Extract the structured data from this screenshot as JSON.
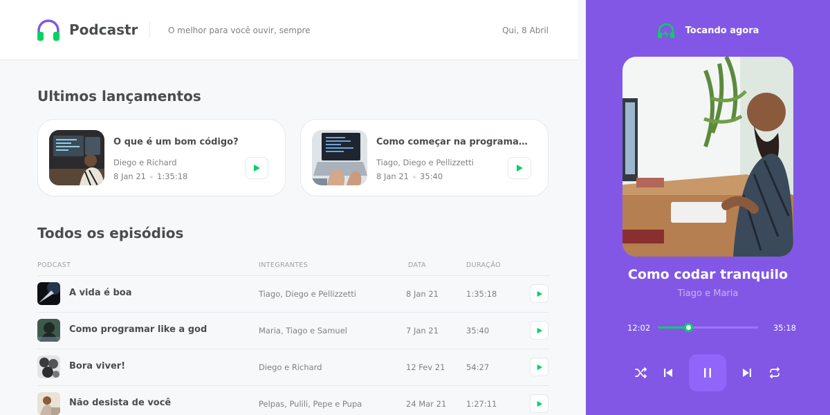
{
  "header": {
    "brand": "Podcastr",
    "tagline": "O melhor para você ouvir, sempre",
    "date": "Qui, 8 Abril"
  },
  "latest": {
    "title": "Ultimos lançamentos",
    "episodes": [
      {
        "title": "O que é um bom código?",
        "members": "Diego e Richard",
        "date": "8 Jan 21",
        "duration": "1:35:18"
      },
      {
        "title": "Como começar na programação",
        "members": "Tiago, Diego e Pellizzetti",
        "date": "8 Jan 21",
        "duration": "35:40"
      }
    ]
  },
  "all": {
    "title": "Todos os episódios",
    "columns": [
      "PODCAST",
      "INTEGRANTES",
      "DATA",
      "DURAÇÃO"
    ],
    "rows": [
      {
        "title": "A vida é boa",
        "members": "Tiago, Diego e Pellizzetti",
        "date": "8 Jan 21",
        "duration": "1:35:18"
      },
      {
        "title": "Como programar like a god",
        "members": "Maria, Tiago e Samuel",
        "date": "7 Jan 21",
        "duration": "35:40"
      },
      {
        "title": "Bora viver!",
        "members": "Diego e Richard",
        "date": "12 Fev 21",
        "duration": "54:27"
      },
      {
        "title": "Não desista de você",
        "members": "Pelpas, Pulili, Pepe e Pupa",
        "date": "24 Mar 21",
        "duration": "1:27:11"
      }
    ]
  },
  "player": {
    "heading": "Tocando agora",
    "title": "Como codar tranquilo",
    "members": "Tiago e Maria",
    "current_time": "12:02",
    "total_time": "35:18",
    "progress": 0.3,
    "controls": [
      "shuffle-icon",
      "previous-icon",
      "pause-icon",
      "next-icon",
      "repeat-icon"
    ]
  },
  "colors": {
    "accent_purple": "#8257e5",
    "accent_green": "#04d361",
    "text_dark": "#494d4b",
    "text_muted": "#808080"
  }
}
